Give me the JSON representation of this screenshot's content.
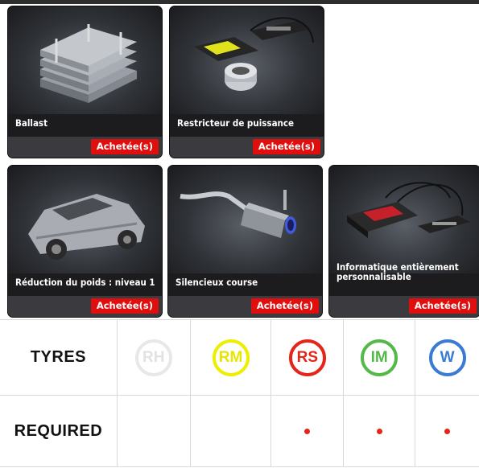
{
  "cards": [
    {
      "title": "Ballast",
      "status": "Achetée(s)",
      "icon": "ballast-plates-image"
    },
    {
      "title": "Restricteur de puissance",
      "status": "Achetée(s)",
      "icon": "power-restrictor-image"
    },
    {
      "title": "Réduction du poids : niveau 1",
      "status": "Achetée(s)",
      "icon": "weight-reduction-car-image"
    },
    {
      "title": "Silencieux course",
      "status": "Achetée(s)",
      "icon": "racing-muffler-image"
    },
    {
      "title": "Informatique entièrement personnalisable",
      "status": "Achetée(s)",
      "icon": "ecu-computer-image"
    }
  ],
  "tyres": {
    "row_label": "TYRES",
    "required_label": "REQUIRED",
    "columns": [
      {
        "code": "RH",
        "color": "#e8e8e8",
        "text_color": "#e2e2e2",
        "required": false
      },
      {
        "code": "RM",
        "color": "#eeee00",
        "text_color": "#e6e600",
        "required": false
      },
      {
        "code": "RS",
        "color": "#e5241a",
        "text_color": "#e5241a",
        "required": true
      },
      {
        "code": "IM",
        "color": "#54b948",
        "text_color": "#54b948",
        "required": true
      },
      {
        "code": "W",
        "color": "#3a7bd5",
        "text_color": "#3a7bd5",
        "required": true
      }
    ]
  }
}
